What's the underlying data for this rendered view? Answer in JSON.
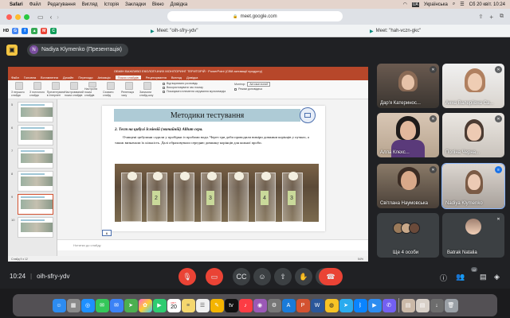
{
  "menubar": {
    "apple": "",
    "items": [
      "Safari",
      "Файл",
      "Редагування",
      "Вигляд",
      "Історія",
      "Закладки",
      "Вікно",
      "Довідка"
    ],
    "keyboard_layout": "Українська",
    "datetime": "Сб 20 квіт. 10:24"
  },
  "browser": {
    "url": "meet.google.com",
    "bookmark_hd": "HD",
    "tabs": [
      {
        "title": "Meet: \"oih-sfry-ydv\""
      },
      {
        "title": "Meet: \"hah-vczn-gkc\""
      }
    ]
  },
  "meet_header": {
    "presenter": "Nadiya Klymenko (Презентація)",
    "presenter_initial": "N"
  },
  "powerpoint": {
    "window_title": "ОБМІН ВАЖЛИВО ЕКОЛОГІЧНИХ МОНІТОРИНГ ТЕРИТОРІЙ · PowerPoint (Сбій активації продукту)",
    "tabs": [
      "Файл",
      "Головна",
      "Вставлення",
      "Дизайн",
      "Переходи",
      "Анімація",
      "Показ слайдів",
      "Рецензування",
      "Вигляд",
      "Довідка"
    ],
    "active_tab": "Показ слайдів",
    "ribbon_groups": [
      "З першого слайда",
      "З поточного слайда",
      "Презентувати в Інтернеті",
      "Настроюваний показ слайдів",
      "Настроїти показ слайдів",
      "Сховати слайд",
      "Репетиція часу",
      "Записати слайд-шоу"
    ],
    "ribbon_checks": [
      "Відтворювати розповідь",
      "Використовувати час показу",
      "Показувати елементи керування мультимедіа"
    ],
    "monitor_label": "Монітор:",
    "monitor_value": "Автоматичний",
    "presenter_view": "Режим доповідача",
    "slide_numbers": [
      "5",
      "6",
      "7",
      "8",
      "9",
      "10"
    ],
    "selected_slide": "9",
    "notes_placeholder": "Нотатки до слайду",
    "status_left": "Слайд 9 з 12",
    "zoom": "54%"
  },
  "slide": {
    "title": "Методики тестування",
    "subtitle": "2. Тест на цибулі Ісміевій (звичайній) Allium сера.",
    "body": "Очищені цибулини садили у пробірки із пробами води. Через три доби проводили виміри довжини корінців у пучках, а також визначали їх кількість. Далі обраховували середню довжину корінців для кожної проби.",
    "tube_tags": [
      "2",
      "3",
      "4",
      "3"
    ],
    "slide_number": "6"
  },
  "participants": [
    {
      "name": "Дар'я Катеринос...",
      "muted": true
    },
    {
      "name": "Анна Валеріївна Са...",
      "muted": true
    },
    {
      "name": "Алла Клєкс...",
      "muted": true
    },
    {
      "name": "Поліна Черна...",
      "muted": true
    },
    {
      "name": "Світлана Наумовська",
      "muted": true
    },
    {
      "name": "Nadiya Klymenko",
      "muted": false
    },
    {
      "name": "Ще 4 особи",
      "muted": false
    },
    {
      "name": "Batrak Natalia",
      "muted": true
    }
  ],
  "meet_bar": {
    "time": "10:24",
    "code": "oih-sfry-ydv",
    "participant_count": "12"
  },
  "dock": {
    "calendar_month": "КВІТ.",
    "calendar_day": "20"
  },
  "colors": {
    "meet_bg": "#202124",
    "ppt_accent": "#b7472a",
    "end_call": "#ea4335",
    "slide_title_bar": "#aecbd6"
  }
}
